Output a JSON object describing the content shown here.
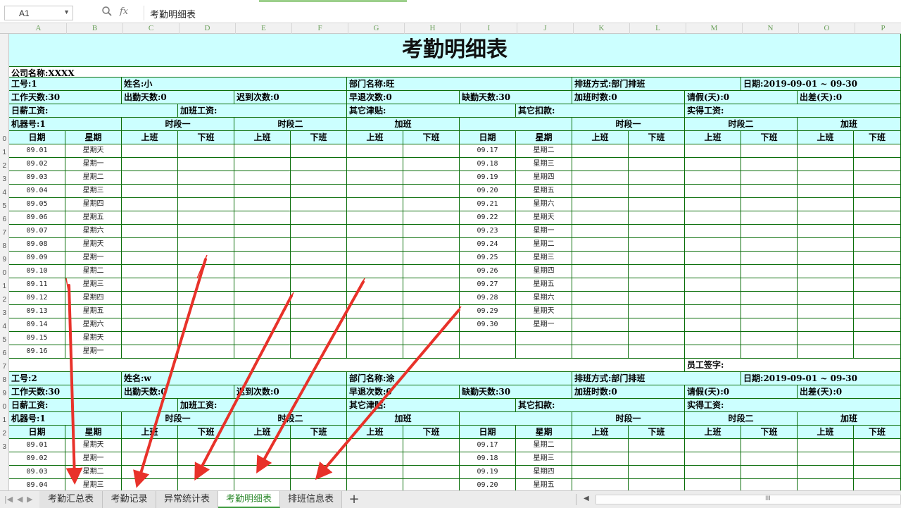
{
  "formula_bar": {
    "cell_ref": "A1",
    "fx_label": "fx",
    "content": "考勤明细表"
  },
  "columns": [
    "A",
    "B",
    "C",
    "D",
    "E",
    "F",
    "G",
    "H",
    "I",
    "J",
    "K",
    "L",
    "M",
    "N",
    "O",
    "P"
  ],
  "row_numbers": [
    "",
    "",
    "",
    "",
    "",
    "",
    "",
    "",
    "",
    "0",
    "1",
    "2",
    "3",
    "4",
    "5",
    "6",
    "7",
    "8",
    "9",
    "0",
    "1",
    "2",
    "3",
    "4",
    "5",
    "6",
    "7",
    "8",
    "9",
    "0",
    "1",
    "2",
    "3"
  ],
  "title": "考勤明细表",
  "company": "公司名称:XXXX",
  "employees": [
    {
      "id": "工号:1",
      "name": "姓名:小",
      "dept": "部门名称:旺",
      "shift_mode": "排班方式:部门排班",
      "date_range": "日期:2019-09-01 ~ 09-30",
      "work_days": "工作天数:30",
      "attend_days": "出勤天数:0",
      "late": "迟到次数:0",
      "early": "早退次数:0",
      "absent": "缺勤天数:30",
      "overtime_hours": "加班时数:0",
      "leave": "请假(天):0",
      "trip": "出差(天):0",
      "daily_wage": "日薪工资:",
      "ot_wage": "加班工资:",
      "allowance": "其它津贴:",
      "deduction": "其它扣款:",
      "actual_wage": "实得工资:",
      "machine": "机器号:1"
    },
    {
      "id": "工号:2",
      "name": "姓名:w",
      "dept": "部门名称:涂",
      "shift_mode": "排班方式:部门排班",
      "date_range": "日期:2019-09-01 ~ 09-30",
      "work_days": "工作天数:30",
      "attend_days": "出勤天数:0",
      "late": "迟到次数:0",
      "early": "早退次数:0",
      "absent": "缺勤天数:30",
      "overtime_hours": "加班时数:0",
      "leave": "请假(天):0",
      "trip": "出差(天):0",
      "daily_wage": "日薪工资:",
      "ot_wage": "加班工资:",
      "allowance": "其它津贴:",
      "deduction": "其它扣款:",
      "actual_wage": "实得工资:",
      "machine": "机器号:1"
    }
  ],
  "headers": {
    "period1": "时段一",
    "period2": "时段二",
    "overtime": "加班",
    "date": "日期",
    "weekday": "星期",
    "on": "上班",
    "off": "下班"
  },
  "left_days": [
    [
      "09.01",
      "星期天"
    ],
    [
      "09.02",
      "星期一"
    ],
    [
      "09.03",
      "星期二"
    ],
    [
      "09.04",
      "星期三"
    ],
    [
      "09.05",
      "星期四"
    ],
    [
      "09.06",
      "星期五"
    ],
    [
      "09.07",
      "星期六"
    ],
    [
      "09.08",
      "星期天"
    ],
    [
      "09.09",
      "星期一"
    ],
    [
      "09.10",
      "星期二"
    ],
    [
      "09.11",
      "星期三"
    ],
    [
      "09.12",
      "星期四"
    ],
    [
      "09.13",
      "星期五"
    ],
    [
      "09.14",
      "星期六"
    ],
    [
      "09.15",
      "星期天"
    ],
    [
      "09.16",
      "星期一"
    ]
  ],
  "right_days": [
    [
      "09.17",
      "星期二"
    ],
    [
      "09.18",
      "星期三"
    ],
    [
      "09.19",
      "星期四"
    ],
    [
      "09.20",
      "星期五"
    ],
    [
      "09.21",
      "星期六"
    ],
    [
      "09.22",
      "星期天"
    ],
    [
      "09.23",
      "星期一"
    ],
    [
      "09.24",
      "星期二"
    ],
    [
      "09.25",
      "星期三"
    ],
    [
      "09.26",
      "星期四"
    ],
    [
      "09.27",
      "星期五"
    ],
    [
      "09.28",
      "星期六"
    ],
    [
      "09.29",
      "星期天"
    ],
    [
      "09.30",
      "星期一"
    ]
  ],
  "signature": "员工签字:",
  "sheet_tabs": [
    "考勤汇总表",
    "考勤记录",
    "异常统计表",
    "考勤明细表",
    "排班信息表"
  ],
  "active_tab": "考勤明细表",
  "add_tab": "+",
  "scroll_grip": "III",
  "colors": {
    "grid": "#0a6e0a",
    "cyan": "#ccffff",
    "arrow": "#e8322a",
    "active_tab": "#2f8a2f"
  }
}
